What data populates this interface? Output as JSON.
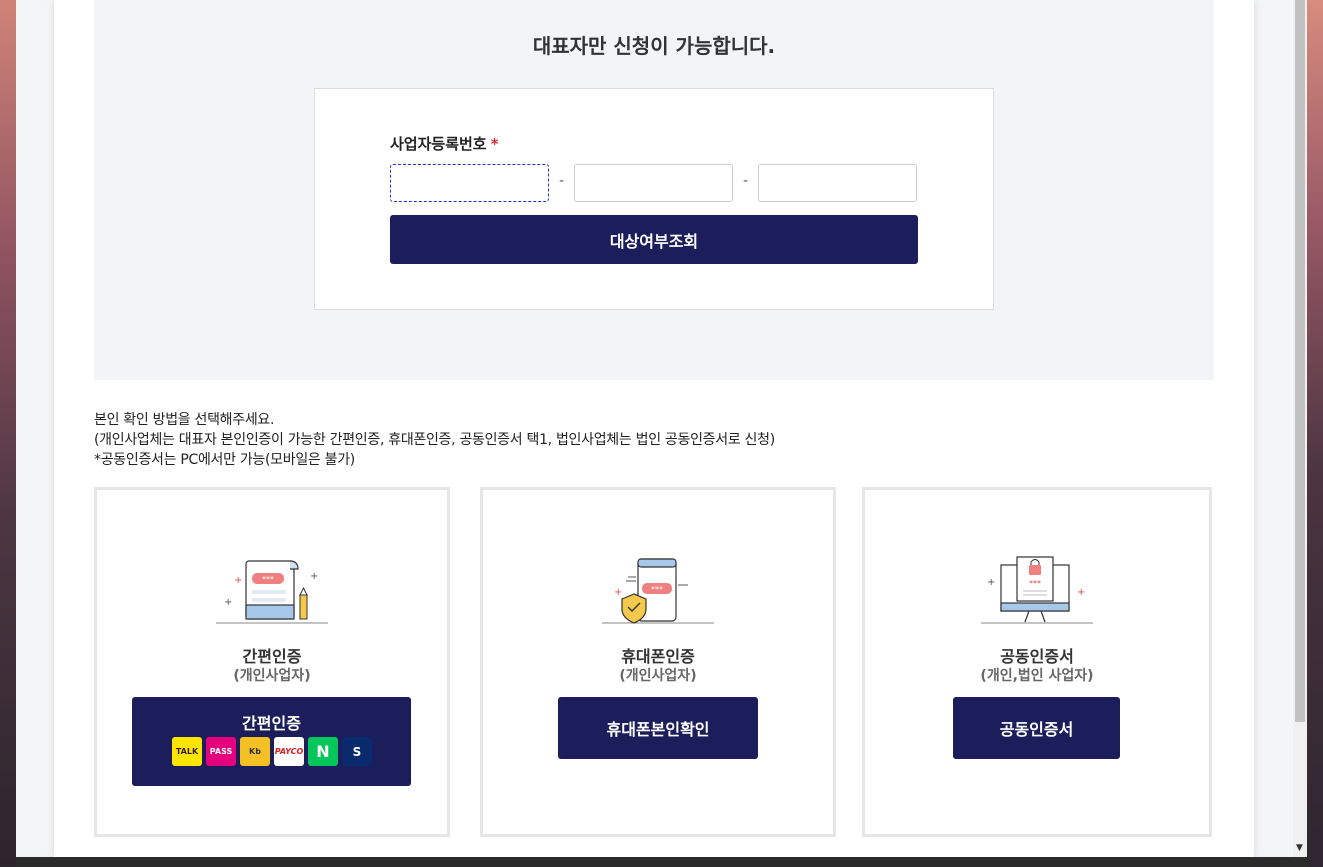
{
  "panel": {
    "title": "대표자만 신청이 가능합니다."
  },
  "form": {
    "label": "사업자등록번호",
    "required_mark": "*",
    "separator": "-",
    "check_button": "대상여부조회"
  },
  "info": {
    "line1": "본인 확인 방법을 선택해주세요.",
    "line2": "(개인사업체는 대표자 본인인증이 가능한 간편인증, 휴대폰인증, 공동인증서 택1, 법인사업체는 법인 공동인증서로 신청)",
    "line3": "*공동인증서는 PC에서만 가능(모바일은 불가)"
  },
  "cards": [
    {
      "title": "간편인증",
      "subtitle": "(개인사업자)",
      "button": "간편인증",
      "logos": [
        {
          "name": "kakao",
          "text": "TALK"
        },
        {
          "name": "pass",
          "text": "PASS"
        },
        {
          "name": "kb",
          "text": "Kb"
        },
        {
          "name": "payco",
          "text": "PAYCO"
        },
        {
          "name": "naver",
          "text": "N"
        },
        {
          "name": "shinhan",
          "text": "S"
        }
      ]
    },
    {
      "title": "휴대폰인증",
      "subtitle": "(개인사업자)",
      "button": "휴대폰본인확인"
    },
    {
      "title": "공동인증서",
      "subtitle": "(개인,법인 사업자)",
      "button": "공동인증서"
    }
  ],
  "colors": {
    "primary": "#1b1e5a",
    "required": "#e0283a",
    "panel_bg": "#f3f4f6"
  }
}
